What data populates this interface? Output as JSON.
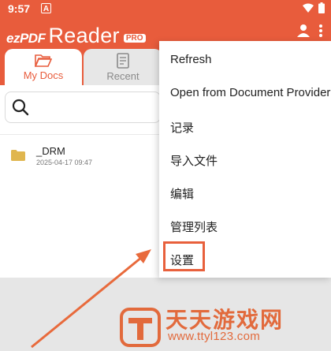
{
  "status_bar": {
    "time": "9:57",
    "badge": "A"
  },
  "app": {
    "logo_ez": "ezPDF",
    "logo_reader": "Reader",
    "logo_pro": "PRO"
  },
  "tabs": [
    {
      "label": "My Docs",
      "icon": "folder-open-icon",
      "active": true
    },
    {
      "label": "Recent",
      "icon": "recent-doc-icon",
      "active": false
    }
  ],
  "search": {
    "placeholder": "",
    "value": ""
  },
  "files": [
    {
      "name": "_DRM",
      "date": "2025-04-17 09:47",
      "icon": "folder-icon"
    }
  ],
  "menu": {
    "items": [
      "Refresh",
      "Open from Document Provider",
      "记录",
      "导入文件",
      "编辑",
      "管理列表",
      "设置"
    ],
    "highlighted_index": 6
  },
  "watermark": {
    "title": "天天游戏网",
    "url": "www.ttyl123.com"
  },
  "colors": {
    "accent": "#e85c3c",
    "highlight": "#e8603c",
    "watermark": "#e26a3c"
  }
}
